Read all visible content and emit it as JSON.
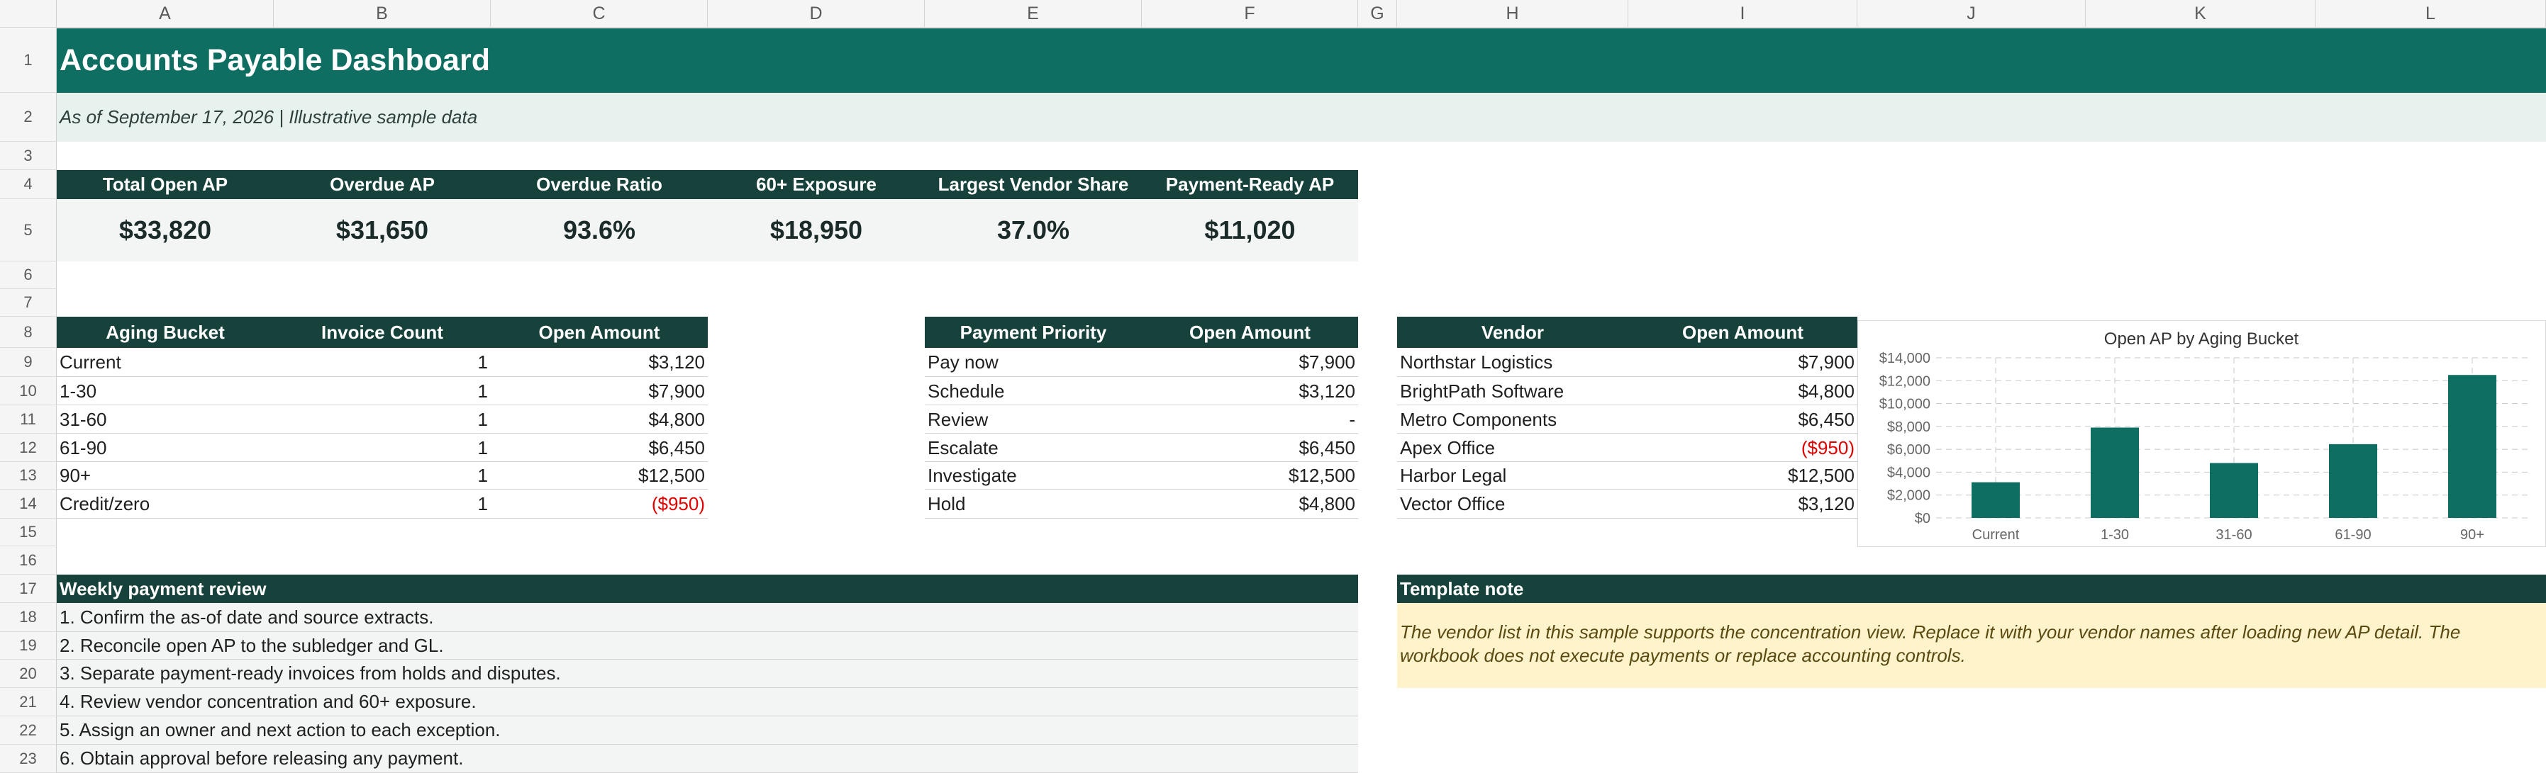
{
  "columns": [
    "A",
    "B",
    "C",
    "D",
    "E",
    "F",
    "G",
    "H",
    "I",
    "J",
    "K",
    "L"
  ],
  "rows": [
    "1",
    "2",
    "3",
    "4",
    "5",
    "6",
    "7",
    "8",
    "9",
    "10",
    "11",
    "12",
    "13",
    "14",
    "15",
    "16",
    "17",
    "18",
    "19",
    "20",
    "21",
    "22",
    "23"
  ],
  "title": "Accounts Payable Dashboard",
  "subtitle": "As of September 17, 2026 | Illustrative sample data",
  "kpis": [
    {
      "label": "Total Open AP",
      "value": "$33,820"
    },
    {
      "label": "Overdue AP",
      "value": "$31,650"
    },
    {
      "label": "Overdue Ratio",
      "value": "93.6%"
    },
    {
      "label": "60+ Exposure",
      "value": "$18,950"
    },
    {
      "label": "Largest Vendor Share",
      "value": "37.0%"
    },
    {
      "label": "Payment-Ready AP",
      "value": "$11,020"
    }
  ],
  "aging": {
    "headers": [
      "Aging Bucket",
      "Invoice Count",
      "Open Amount"
    ],
    "rows": [
      {
        "bucket": "Current",
        "count": "1",
        "amount": "$3,120"
      },
      {
        "bucket": "1-30",
        "count": "1",
        "amount": "$7,900"
      },
      {
        "bucket": "31-60",
        "count": "1",
        "amount": "$4,800"
      },
      {
        "bucket": "61-90",
        "count": "1",
        "amount": "$6,450"
      },
      {
        "bucket": "90+",
        "count": "1",
        "amount": "$12,500"
      },
      {
        "bucket": "Credit/zero",
        "count": "1",
        "amount": "($950)"
      }
    ]
  },
  "priority": {
    "headers": [
      "Payment Priority",
      "Open Amount"
    ],
    "rows": [
      {
        "name": "Pay now",
        "amount": "$7,900"
      },
      {
        "name": "Schedule",
        "amount": "$3,120"
      },
      {
        "name": "Review",
        "amount": "-"
      },
      {
        "name": "Escalate",
        "amount": "$6,450"
      },
      {
        "name": "Investigate",
        "amount": "$12,500"
      },
      {
        "name": "Hold",
        "amount": "$4,800"
      }
    ]
  },
  "vendors": {
    "headers": [
      "Vendor",
      "Open Amount"
    ],
    "rows": [
      {
        "name": "Northstar Logistics",
        "amount": "$7,900"
      },
      {
        "name": "BrightPath Software",
        "amount": "$4,800"
      },
      {
        "name": "Metro Components",
        "amount": "$6,450"
      },
      {
        "name": "Apex Office",
        "amount": "($950)"
      },
      {
        "name": "Harbor Legal",
        "amount": "$12,500"
      },
      {
        "name": "Vector Office",
        "amount": "$3,120"
      }
    ]
  },
  "review": {
    "title": "Weekly payment review",
    "items": [
      "1. Confirm the as-of date and source extracts.",
      "2. Reconcile open AP to the subledger and GL.",
      "3. Separate payment-ready invoices from holds and disputes.",
      "4. Review vendor concentration and 60+ exposure.",
      "5. Assign an owner and next action to each exception.",
      "6. Obtain approval before releasing any payment."
    ]
  },
  "note": {
    "title": "Template note",
    "line1": "The vendor list in this sample supports the concentration view. Replace it with your vendor names after loading new AP detail. The",
    "line2": "workbook does not execute payments or replace accounting controls."
  },
  "colors": {
    "title_band": "#0f6e62",
    "header_dark": "#17423b",
    "bar": "#0f6e62",
    "negative": "#e00000",
    "note_band": "#fff3cc"
  },
  "chart_data": {
    "type": "bar",
    "title": "Open AP by Aging Bucket",
    "categories": [
      "Current",
      "1-30",
      "31-60",
      "61-90",
      "90+"
    ],
    "values": [
      3120,
      7900,
      4800,
      6450,
      12500
    ],
    "ylim": [
      0,
      14000
    ],
    "yticks": [
      "$0",
      "$2,000",
      "$4,000",
      "$6,000",
      "$8,000",
      "$10,000",
      "$12,000",
      "$14,000"
    ],
    "grid": true,
    "legend": "none"
  }
}
